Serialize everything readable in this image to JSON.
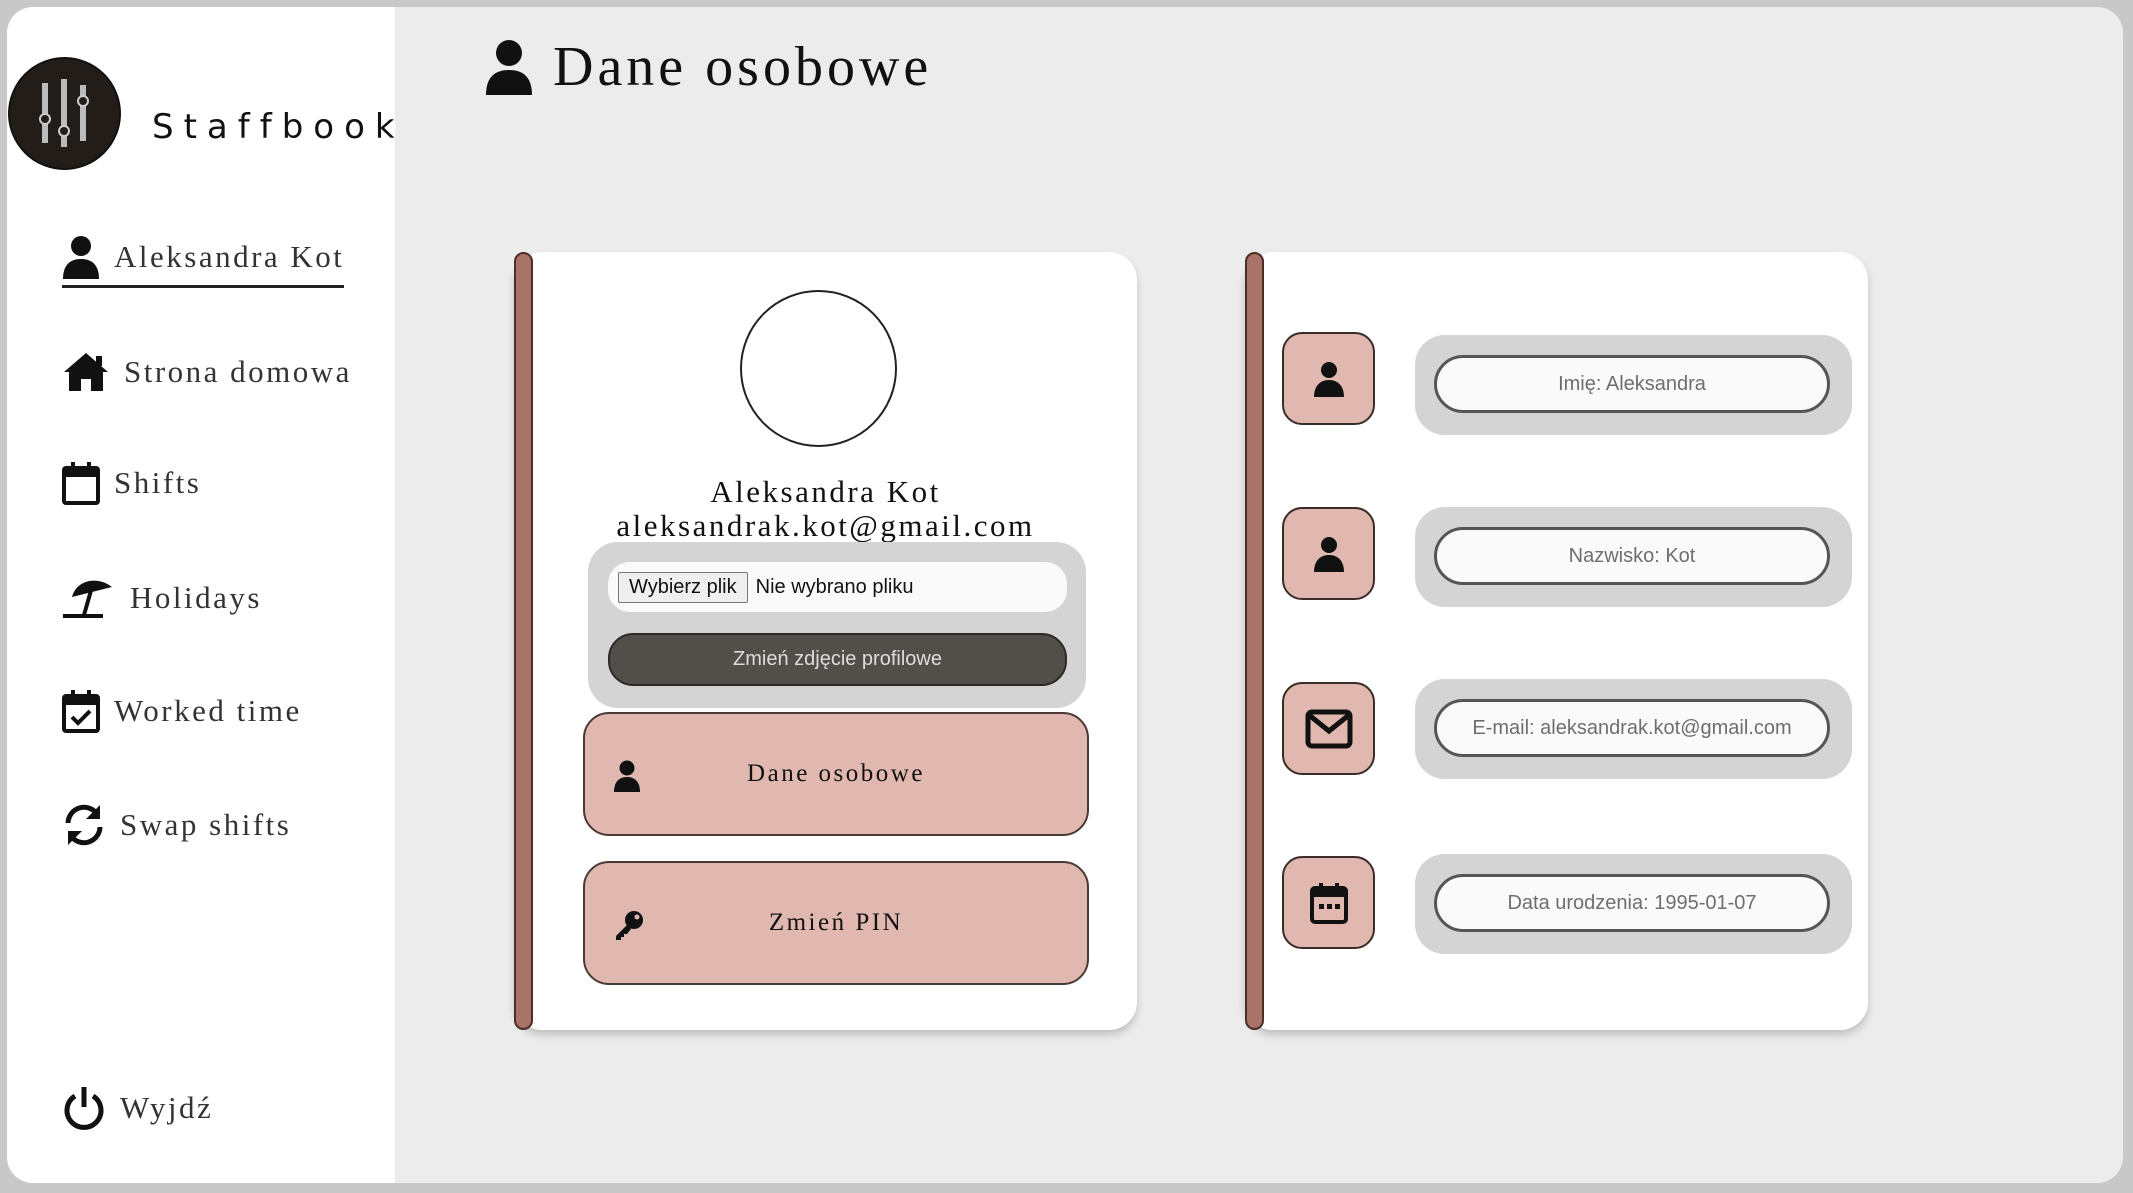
{
  "app": {
    "brand": "Staffbook"
  },
  "sidebar": {
    "items": [
      {
        "label": "Aleksandra Kot",
        "icon": "user-icon"
      },
      {
        "label": "Strona domowa",
        "icon": "home-icon"
      },
      {
        "label": "Shifts",
        "icon": "calendar-icon"
      },
      {
        "label": "Holidays",
        "icon": "umbrella-beach-icon"
      },
      {
        "label": "Worked time",
        "icon": "calendar-check-icon"
      },
      {
        "label": "Swap shifts",
        "icon": "refresh-icon"
      }
    ],
    "logout": {
      "label": "Wyjdź",
      "icon": "power-icon"
    }
  },
  "header": {
    "title": "Dane osobowe",
    "icon": "user-icon"
  },
  "profile": {
    "name": "Aleksandra Kot",
    "email": "aleksandrak.kot@gmail.com",
    "file_button": "Wybierz plik",
    "file_status": "Nie wybrano pliku",
    "change_photo": "Zmień zdjęcie profilowe",
    "menu": [
      {
        "label": "Dane osobowe",
        "icon": "user-icon"
      },
      {
        "label": "Zmień PIN",
        "icon": "key-icon"
      }
    ]
  },
  "details": {
    "fields": [
      {
        "placeholder": "Imię: Aleksandra",
        "icon": "user-icon"
      },
      {
        "placeholder": "Nazwisko: Kot",
        "icon": "user-icon"
      },
      {
        "placeholder": "E-mail: aleksandrak.kot@gmail.com",
        "icon": "envelope-icon"
      },
      {
        "placeholder": "Data urodzenia: 1995-01-07",
        "icon": "calendar-icon"
      }
    ]
  },
  "colors": {
    "accent_bar": "#a87368",
    "button_pink": "#e0b8b0",
    "dark_button": "#524e4a",
    "background": "#ececec"
  }
}
